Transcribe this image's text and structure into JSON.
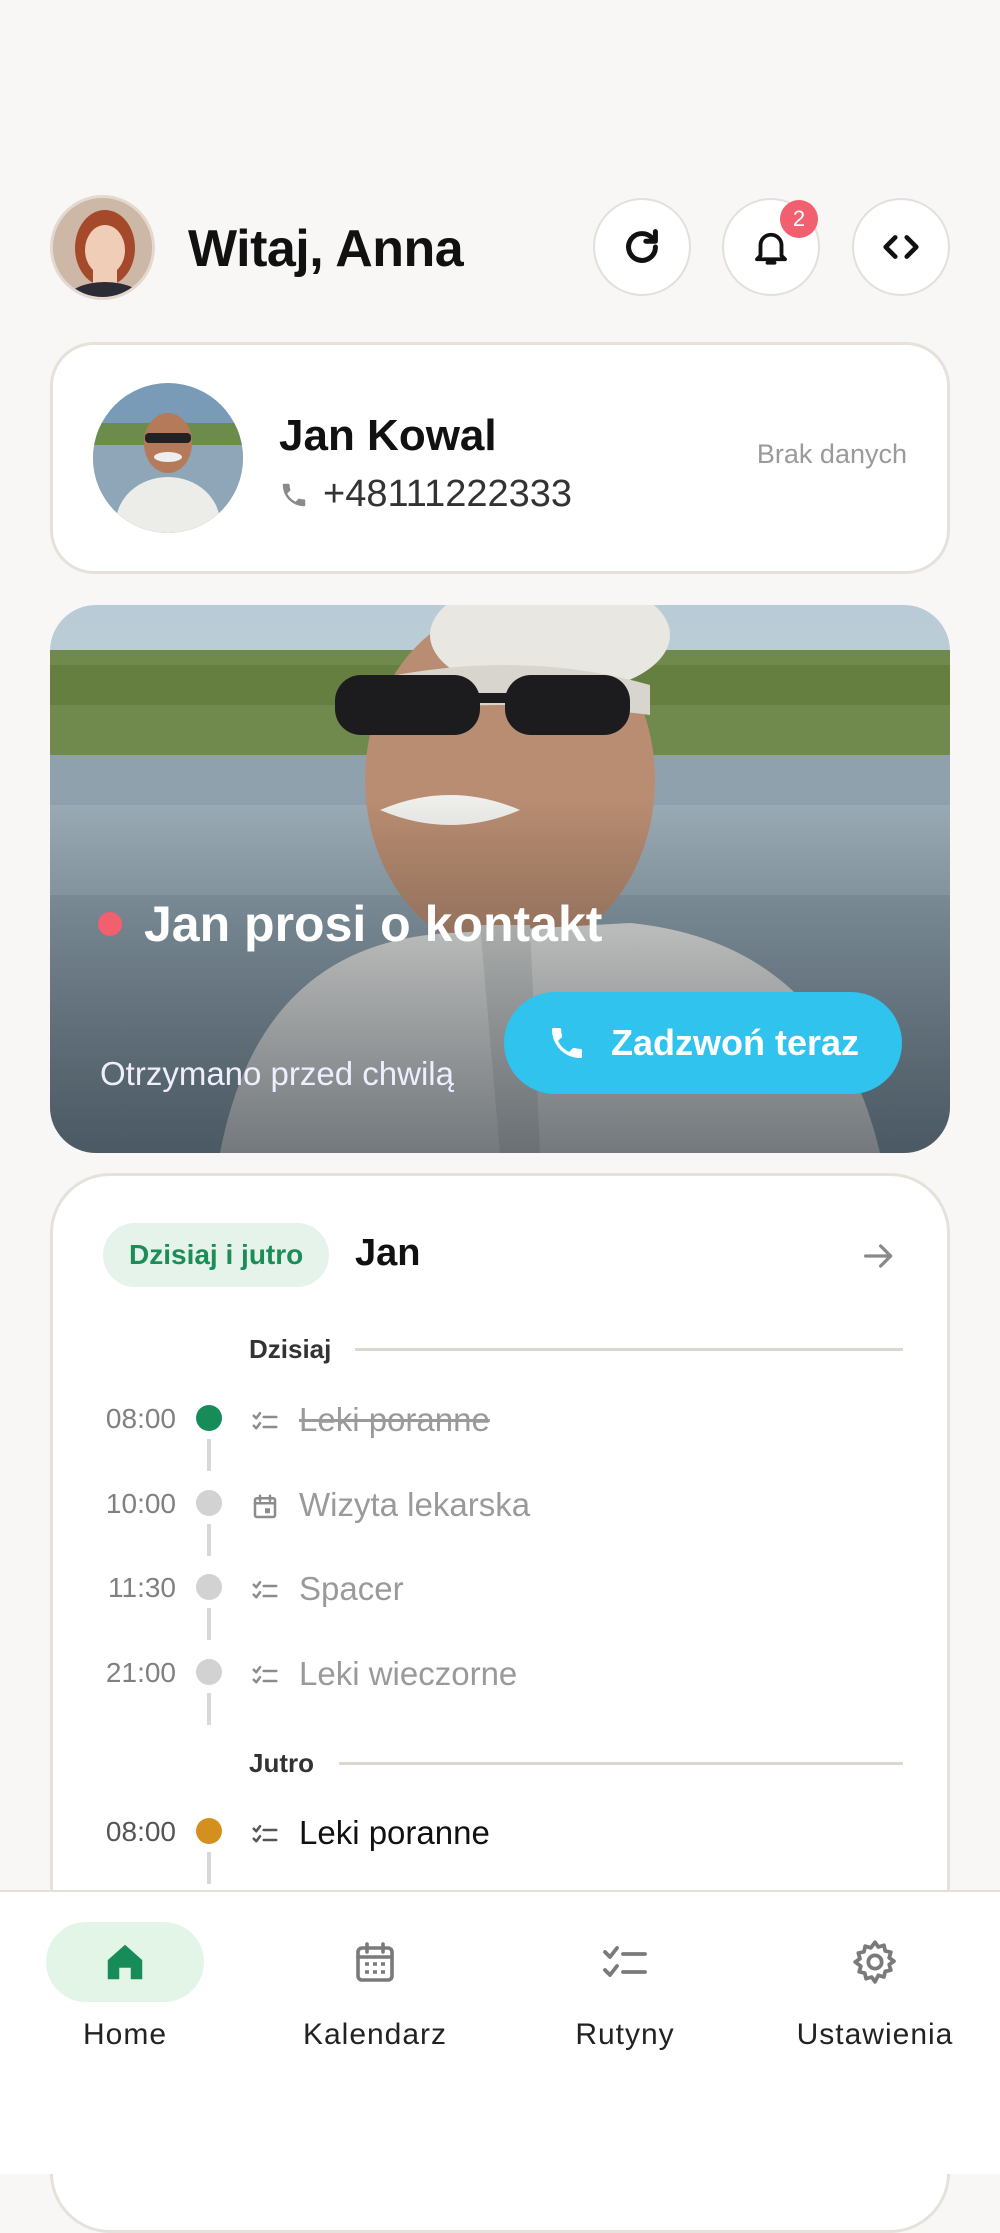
{
  "header": {
    "greeting": "Witaj, Anna",
    "notifications_count": "2"
  },
  "contact": {
    "name": "Jan Kowal",
    "phone": "+48111222333",
    "status": "Brak danych"
  },
  "alert": {
    "title": "Jan prosi o kontakt",
    "subtitle": "Otrzymano przed chwilą",
    "call_label": "Zadzwoń teraz"
  },
  "schedule": {
    "chip": "Dzisiaj i jutro",
    "person": "Jan",
    "today_label": "Dzisiaj",
    "tomorrow_label": "Jutro",
    "today": [
      {
        "time": "08:00",
        "label": "Leki poranne",
        "type": "routine",
        "state": "done"
      },
      {
        "time": "10:00",
        "label": "Wizyta lekarska",
        "type": "calendar",
        "state": "pending"
      },
      {
        "time": "11:30",
        "label": "Spacer",
        "type": "routine",
        "state": "pending"
      },
      {
        "time": "21:00",
        "label": "Leki wieczorne",
        "type": "routine",
        "state": "pending"
      }
    ],
    "tomorrow": [
      {
        "time": "08:00",
        "label": "Leki poranne",
        "type": "routine",
        "state": "active"
      }
    ],
    "colors": {
      "done": "#178c58",
      "pending": "#d2d2d2",
      "active": "#d4901e"
    }
  },
  "nav": {
    "home": "Home",
    "calendar": "Kalendarz",
    "routines": "Rutyny",
    "settings": "Ustawienia"
  },
  "icons": [
    "refresh-icon",
    "bell-icon",
    "code-icon",
    "phone-icon",
    "arrow-right-icon",
    "checklist-icon",
    "calendar-icon",
    "home-icon",
    "gear-icon"
  ]
}
